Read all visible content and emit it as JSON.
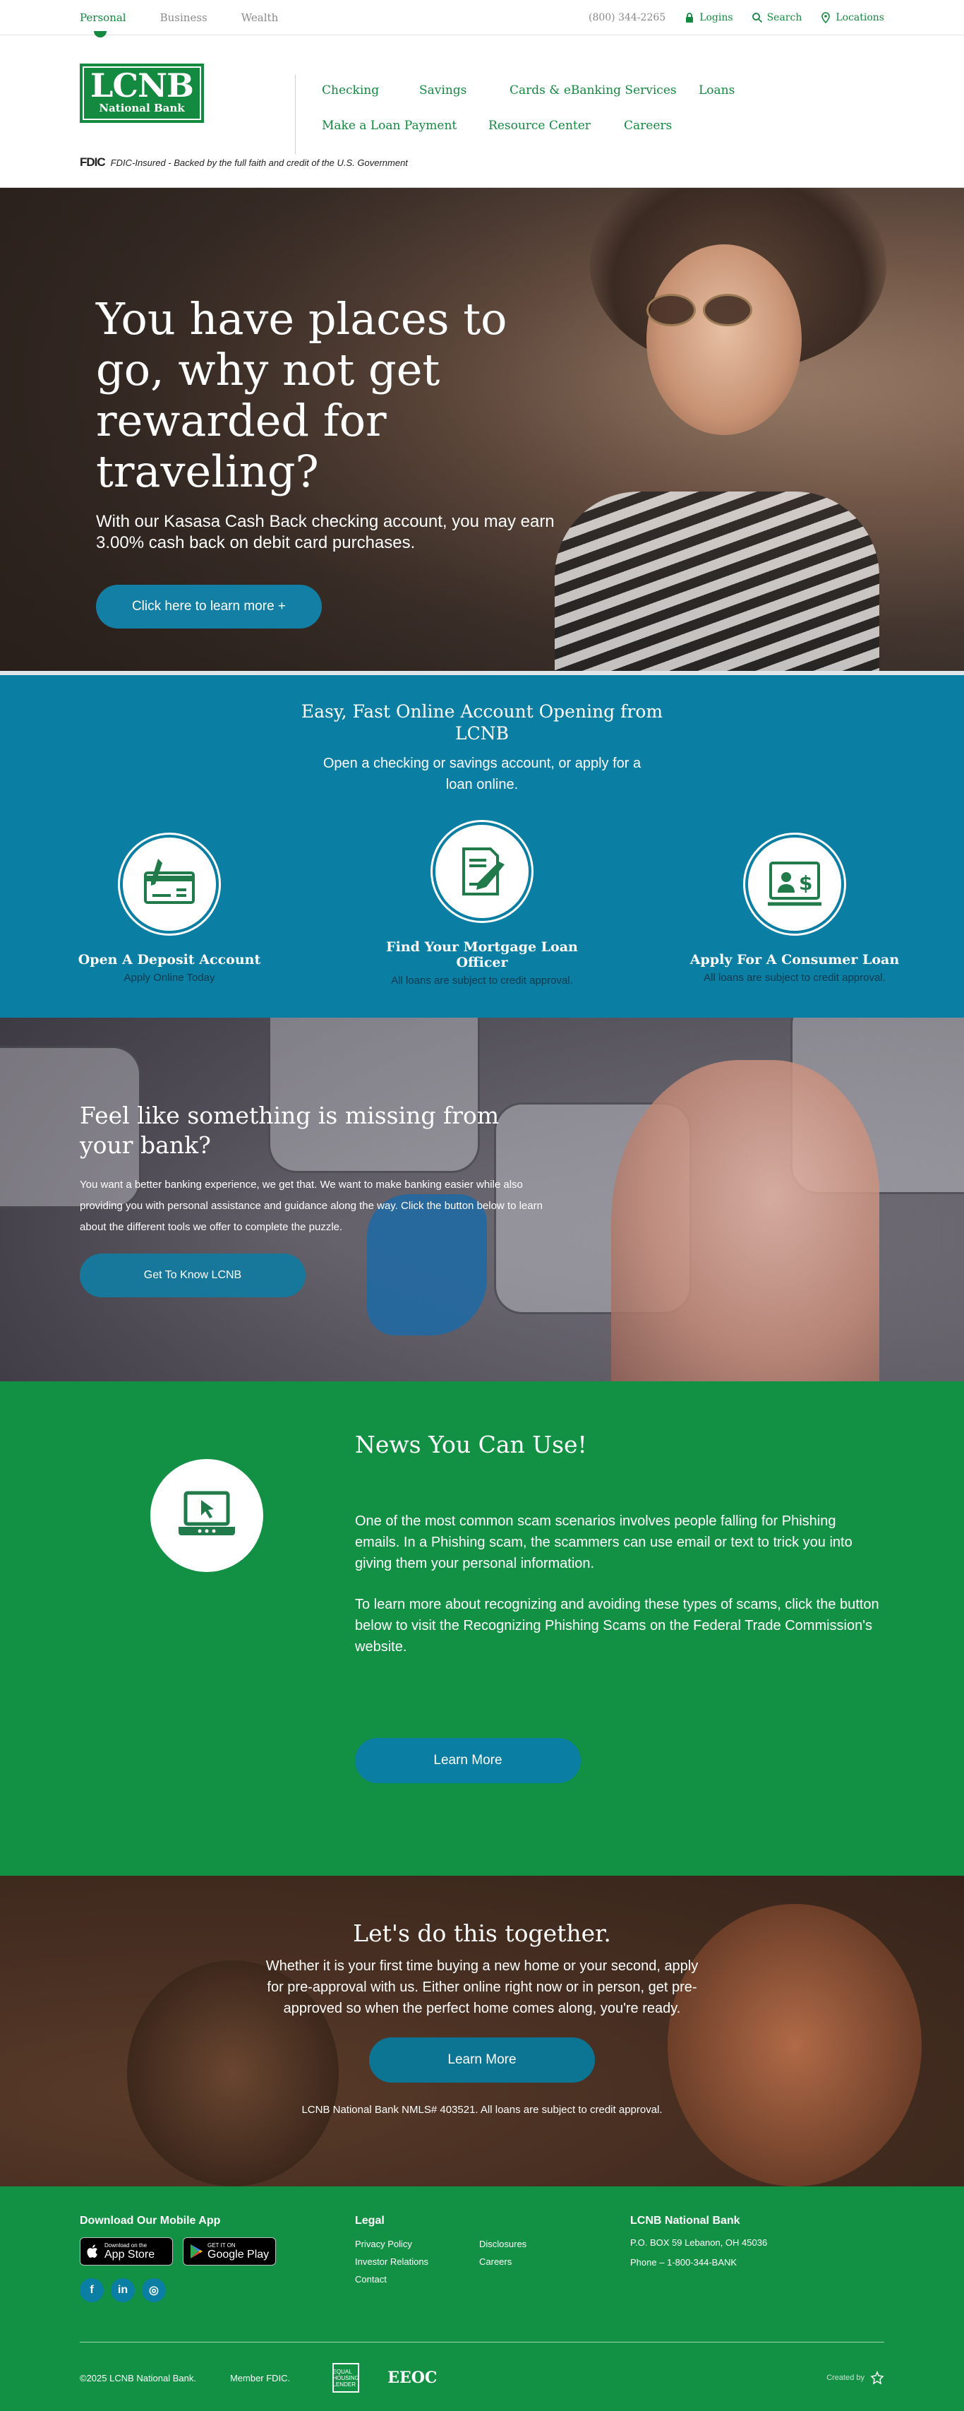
{
  "topbar": {
    "segments": [
      "Personal",
      "Business",
      "Wealth"
    ],
    "phone": "(800) 344-2265",
    "logins": "Logins",
    "search": "Search",
    "locations": "Locations"
  },
  "header": {
    "logo_big": "LCNB",
    "logo_small": "National Bank",
    "fdic_mark": "FDIC",
    "fdic_text": "FDIC-Insured - Backed by the full faith and credit of the U.S. Government",
    "nav_row1": [
      "Checking",
      "Savings",
      "Cards & eBanking Services",
      "Loans"
    ],
    "nav_row2": [
      "Make a Loan Payment",
      "Resource Center",
      "Careers"
    ]
  },
  "hero": {
    "title": "You have places to go, why not get rewarded for traveling?",
    "body": "With our Kasasa Cash Back checking account, you may earn 3.00% cash back on debit card purchases.",
    "button": "Click here to learn more +"
  },
  "accounts": {
    "title": "Easy, Fast Online Account Opening from LCNB",
    "subtitle": "Open a checking or savings account, or apply for a loan online.",
    "cards": [
      {
        "title": "Open A Deposit Account",
        "text": "Apply Online Today",
        "icon": "check-icon"
      },
      {
        "title": "Find Your Mortgage Loan Officer",
        "text": "All loans are subject to credit approval.",
        "icon": "document-pen-icon"
      },
      {
        "title": "Apply For A Consumer Loan",
        "text": "All loans are subject to credit approval.",
        "icon": "loan-officer-icon"
      }
    ]
  },
  "puzzle": {
    "title": "Feel like something is missing from your bank?",
    "body": "You want a better banking experience, we get that. We want to make banking easier while also providing you with personal assistance and guidance along the way. Click the button below to learn about the different tools we offer to complete the puzzle.",
    "button": "Get To Know LCNB"
  },
  "news": {
    "title": "News You Can Use!",
    "p1": "One of the most common scam scenarios involves people falling for Phishing emails. In a Phishing scam, the scammers can use email or text to trick you into giving them your personal information.",
    "p2": "To learn more about recognizing and avoiding these types of scams, click the button below to visit the Recognizing Phishing Scams on the Federal Trade Commission's website.",
    "button": "Learn More",
    "icon": "laptop-cursor-icon"
  },
  "together": {
    "title": "Let's do this together.",
    "body": "Whether it is your first time buying a new home or your second, apply for pre-approval with us. Either online right now or in person, get pre-approved so when the perfect home comes along, you're ready.",
    "button": "Learn More",
    "nmls": "LCNB National Bank NMLS# 403521. All loans are subject to credit approval."
  },
  "footer": {
    "app_heading": "Download Our Mobile App",
    "appstore_small": "Download on the",
    "appstore_big": "App Store",
    "play_small": "GET IT ON",
    "play_big": "Google Play",
    "social": [
      "f",
      "in",
      "◎"
    ],
    "legal_heading": "Legal",
    "legal_links": [
      "Privacy Policy",
      "Disclosures",
      "Investor Relations",
      "Careers",
      "Contact"
    ],
    "bank_heading": "LCNB National Bank",
    "address": "P.O. BOX 59 Lebanon, OH 45036",
    "phone": "Phone – 1-800-344-BANK",
    "copyright": "©2025 LCNB National Bank.",
    "member": "Member FDIC.",
    "eho": "EQUAL HOUSING LENDER",
    "eeoc": "EEOC",
    "created_by": "Created by"
  },
  "colors": {
    "brand_green": "#138a3f",
    "accent_blue": "#0a7ea3",
    "footer_green": "#129145"
  }
}
